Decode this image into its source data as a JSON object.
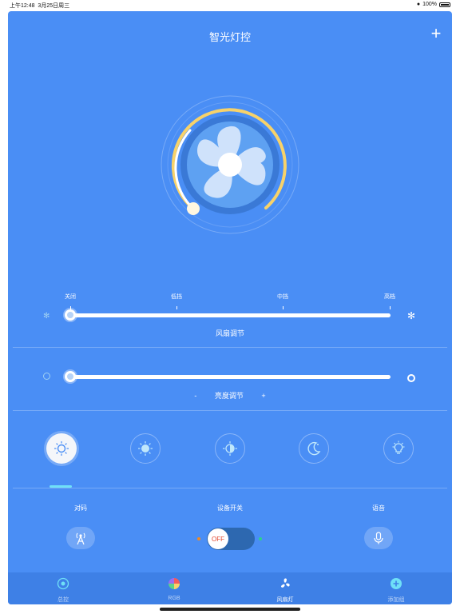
{
  "status_bar": {
    "time": "上午12:48",
    "date": "3月25日周三",
    "battery": "100%"
  },
  "header": {
    "title": "智光灯控",
    "add_icon": "plus-icon"
  },
  "fan_dial": {
    "icon": "fan-icon",
    "level": 0,
    "arc_color": "#f7d26a"
  },
  "fan_slider": {
    "ticks": [
      "关闭",
      "低挡",
      "中挡",
      "高档"
    ],
    "value_index": 0,
    "caption": "风扇调节",
    "left_icon": "fan-small-icon",
    "right_icon": "fan-large-icon"
  },
  "brightness_slider": {
    "value": 0,
    "caption": "亮度调节",
    "minus_label": "-",
    "plus_label": "+",
    "left_icon": "dim-icon",
    "right_icon": "bright-icon"
  },
  "modes": [
    {
      "name": "sun-outline-icon",
      "active": true
    },
    {
      "name": "sun-solid-icon",
      "active": false
    },
    {
      "name": "sun-half-icon",
      "active": false
    },
    {
      "name": "moon-icon",
      "active": false
    },
    {
      "name": "bulb-icon",
      "active": false
    }
  ],
  "controls": {
    "pair_label": "对码",
    "power_label": "设备开关",
    "voice_label": "语音",
    "switch_state": "OFF",
    "pair_icon": "antenna-icon",
    "voice_icon": "microphone-icon"
  },
  "tabs": [
    {
      "label": "总控",
      "icon": "control-icon",
      "active": false
    },
    {
      "label": "RGB",
      "icon": "color-wheel-icon",
      "active": false
    },
    {
      "label": "风扇灯",
      "icon": "fan-icon",
      "active": true
    },
    {
      "label": "添加组",
      "icon": "add-circle-icon",
      "active": false
    }
  ],
  "colors": {
    "background": "#4a8ef5",
    "tabbar": "#3e80e6",
    "accent": "#6fe0f7",
    "switch_off": "#2d68b0"
  }
}
